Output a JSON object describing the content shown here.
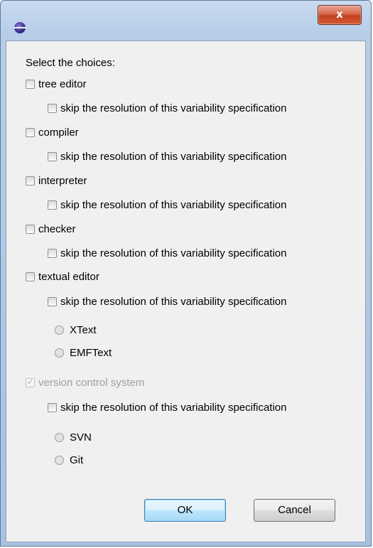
{
  "window": {
    "title": "",
    "close_label": "x"
  },
  "dialog": {
    "header": "Select the choices:",
    "skip_label": "skip the resolution of this variability specification",
    "features": [
      {
        "label": "tree editor",
        "checked": false,
        "enabled": true
      },
      {
        "label": "compiler",
        "checked": false,
        "enabled": true
      },
      {
        "label": "interpreter",
        "checked": false,
        "enabled": true
      },
      {
        "label": "checker",
        "checked": false,
        "enabled": true
      },
      {
        "label": "textual editor",
        "checked": false,
        "enabled": true,
        "options": [
          "XText",
          "EMFText"
        ]
      },
      {
        "label": "version control system",
        "checked": true,
        "enabled": false,
        "options": [
          "SVN",
          "Git"
        ]
      }
    ],
    "buttons": {
      "ok": "OK",
      "cancel": "Cancel"
    }
  },
  "icons": {
    "app": "eclipse-icon",
    "close": "close-icon",
    "check": "checkmark-icon"
  }
}
